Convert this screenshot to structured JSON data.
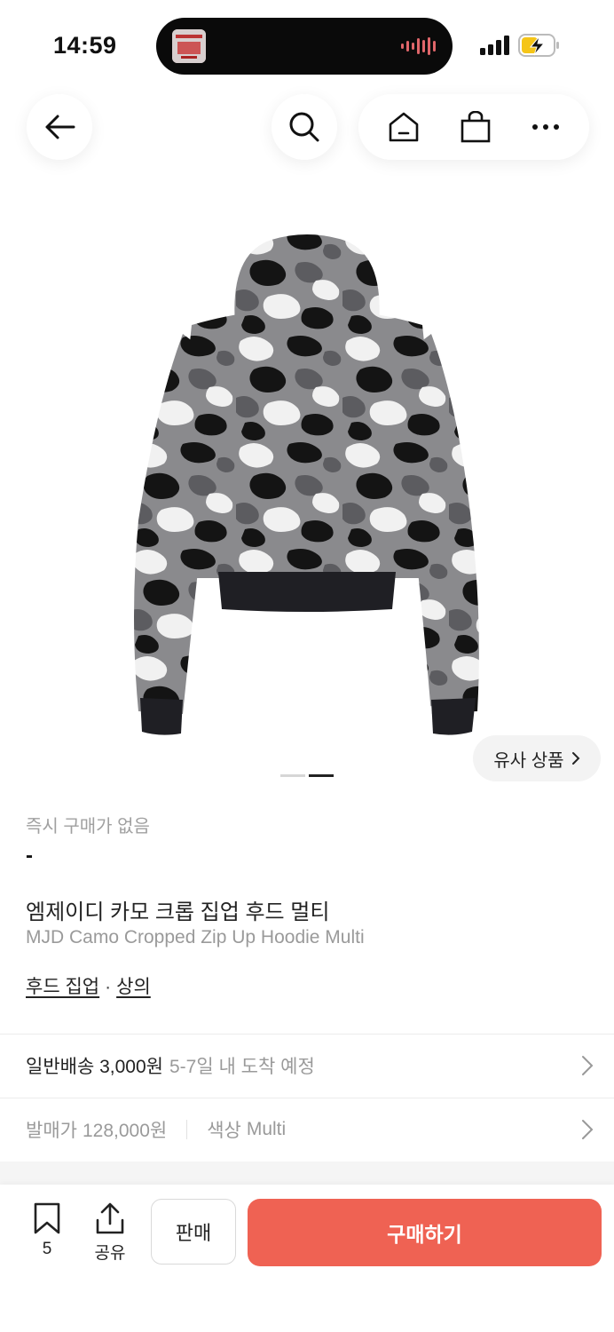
{
  "status_bar": {
    "time": "14:59"
  },
  "product": {
    "instant_buy_label": "즉시 구매가 없음",
    "instant_buy_price": "-",
    "name_ko": "엠제이디 카모 크롭 집업 후드 멀티",
    "name_en": "MJD Camo Cropped Zip Up Hoodie Multi",
    "category_primary": "후드 집업",
    "category_separator": "·",
    "category_secondary": "상의",
    "similar_button": "유사 상품"
  },
  "shipping": {
    "label": "일반배송 3,000원",
    "eta": "5-7일 내 도착 예정"
  },
  "release": {
    "price_label": "발매가",
    "price_value": "128,000원",
    "color_label": "색상",
    "color_value": "Multi"
  },
  "bottom_bar": {
    "save_count": "5",
    "share_label": "공유",
    "sell_label": "판매",
    "buy_label": "구매하기"
  },
  "colors": {
    "accent": "#ef6253",
    "muted_text": "#9a9a9a"
  },
  "icons": [
    "back-arrow-icon",
    "search-icon",
    "home-icon",
    "shopping-bag-icon",
    "more-icon",
    "bookmark-icon",
    "share-icon",
    "chevron-right-icon"
  ]
}
